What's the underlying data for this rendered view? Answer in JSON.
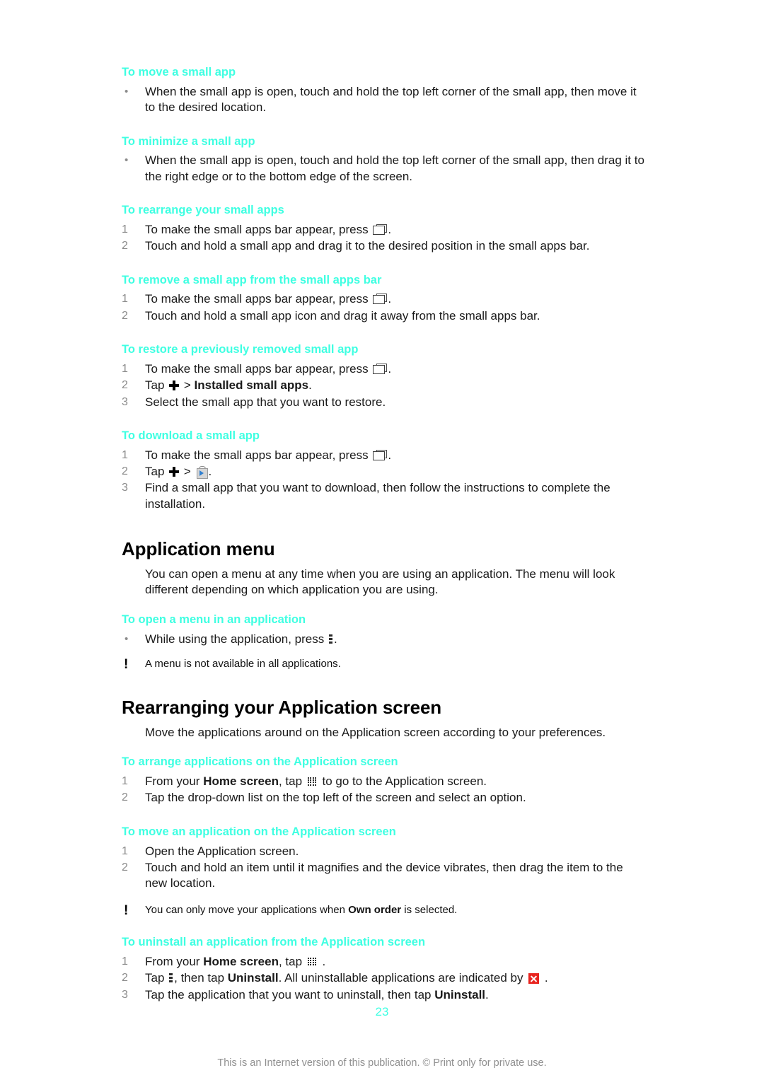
{
  "document": {
    "page_number": "23",
    "footer_note": "This is an Internet version of this publication. © Print only for private use.",
    "heading_color": "#3FFFE2",
    "note_marker": "!"
  },
  "procedures": {
    "move_small_app": {
      "title": "To move a small app",
      "bullet_marker": "•",
      "step1": "When the small app is open, touch and hold the top left corner of the small app, then move it to the desired location."
    },
    "minimize_small_app": {
      "title": "To minimize a small app",
      "bullet_marker": "•",
      "step1": "When the small app is open, touch and hold the top left corner of the small app, then drag it to the right edge or to the bottom edge of the screen."
    },
    "rearrange_small_apps": {
      "title": "To rearrange your small apps",
      "num1": "1",
      "step1_pre": "To make the small apps bar appear, press ",
      "step1_post": ".",
      "num2": "2",
      "step2": "Touch and hold a small app and drag it to the desired position in the small apps bar."
    },
    "remove_small_app": {
      "title": "To remove a small app from the small apps bar",
      "num1": "1",
      "step1_pre": "To make the small apps bar appear, press ",
      "step1_post": ".",
      "num2": "2",
      "step2": "Touch and hold a small app icon and drag it away from the small apps bar."
    },
    "restore_small_app": {
      "title": "To restore a previously removed small app",
      "num1": "1",
      "step1_pre": "To make the small apps bar appear, press ",
      "step1_post": ".",
      "num2": "2",
      "step2_pre": "Tap ",
      "step2_sep": " > ",
      "step2_bold": "Installed small apps",
      "step2_post": ".",
      "num3": "3",
      "step3": "Select the small app that you want to restore."
    },
    "download_small_app": {
      "title": "To download a small app",
      "num1": "1",
      "step1_pre": "To make the small apps bar appear, press ",
      "step1_post": ".",
      "num2": "2",
      "step2_pre": "Tap ",
      "step2_sep": " > ",
      "step2_post": ".",
      "num3": "3",
      "step3": "Find a small app that you want to download, then follow the instructions to complete the installation."
    },
    "open_menu": {
      "title": "To open a menu in an application",
      "bullet_marker": "•",
      "step1_pre": "While using the application, press ",
      "step1_post": ".",
      "note": "A menu is not available in all applications."
    },
    "arrange_applications": {
      "title": "To arrange applications on the Application screen",
      "num1": "1",
      "step1_pre": "From your ",
      "step1_bold": "Home screen",
      "step1_mid": ", tap ",
      "step1_post": " to go to the Application screen.",
      "num2": "2",
      "step2": "Tap the drop-down list on the top left of the screen and select an option."
    },
    "move_application": {
      "title": "To move an application on the Application screen",
      "num1": "1",
      "step1": "Open the Application screen.",
      "num2": "2",
      "step2": "Touch and hold an item until it magnifies and the device vibrates, then drag the item to the new location.",
      "note_pre": "You can only move your applications when ",
      "note_bold": "Own order",
      "note_post": " is selected."
    },
    "uninstall_application": {
      "title": "To uninstall an application from the Application screen",
      "num1": "1",
      "step1_pre": "From your ",
      "step1_bold": "Home screen",
      "step1_mid": ", tap ",
      "step1_post": " .",
      "num2": "2",
      "step2_pre": "Tap ",
      "step2_mid": ", then tap ",
      "step2_bold": "Uninstall",
      "step2_mid2": ". All uninstallable applications are indicated by ",
      "step2_post": " .",
      "num3": "3",
      "step3_pre": "Tap the application that you want to uninstall, then tap ",
      "step3_bold": "Uninstall",
      "step3_post": "."
    }
  },
  "sections": {
    "application_menu": {
      "title": "Application menu",
      "intro": "You can open a menu at any time when you are using an application. The menu will look different depending on which application you are using."
    },
    "rearranging_application_screen": {
      "title": "Rearranging your Application screen",
      "intro": "Move the applications around on the Application screen according to your preferences."
    }
  }
}
